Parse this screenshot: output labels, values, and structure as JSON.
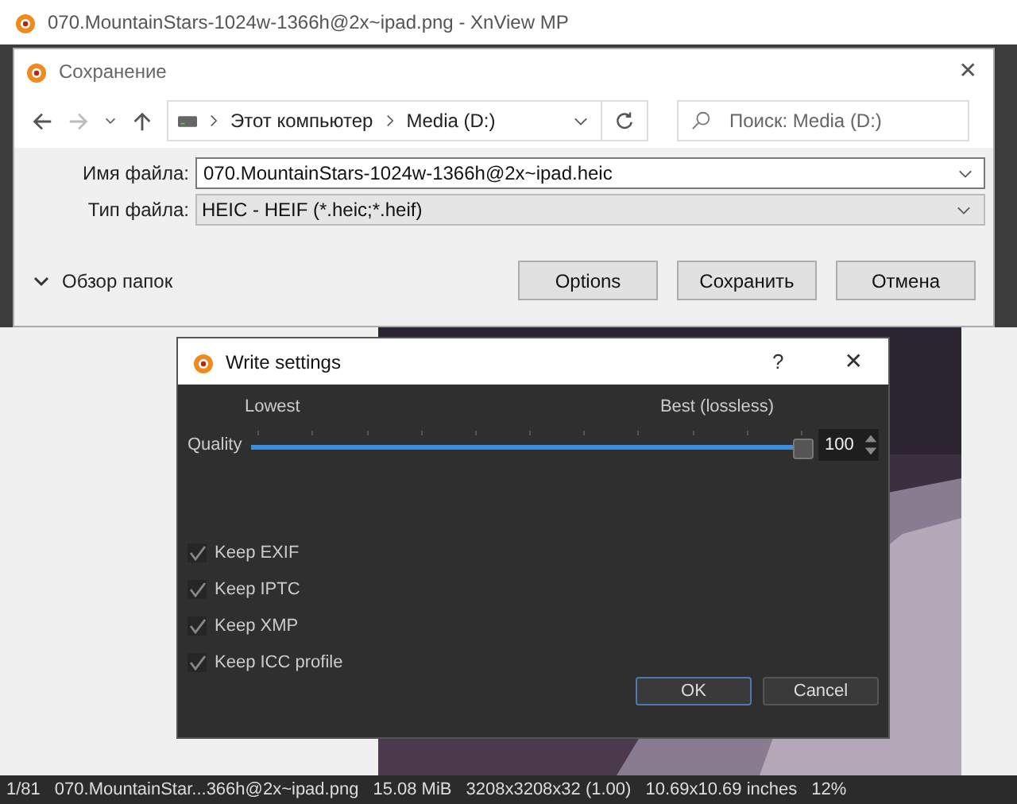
{
  "main_window": {
    "title": "070.MountainStars-1024w-1366h@2x~ipad.png - XnView MP"
  },
  "save_dialog": {
    "title": "Сохранение",
    "close": "✕",
    "breadcrumb": [
      "Этот компьютер",
      "Media (D:)"
    ],
    "search": {
      "placeholder": "Поиск: Media (D:)"
    },
    "fields": [
      {
        "label": "Имя файла:",
        "value": "070.MountainStars-1024w-1366h@2x~ipad.heic",
        "kind": "input"
      },
      {
        "label": "Тип файла:",
        "value": "HEIC - HEIF (*.heic;*.heif)",
        "kind": "select"
      }
    ],
    "browse_toggle": "Обзор папок",
    "buttons": [
      "Options",
      "Сохранить",
      "Отмена"
    ]
  },
  "write_dialog": {
    "title": "Write settings",
    "help": "?",
    "close": "✕",
    "quality": {
      "label": "Quality",
      "min_label": "Lowest",
      "max_label": "Best (lossless)",
      "level": 1,
      "value": "100"
    },
    "options": [
      {
        "label": "Keep EXIF",
        "checked": true
      },
      {
        "label": "Keep IPTC",
        "checked": true
      },
      {
        "label": "Keep XMP",
        "checked": true
      },
      {
        "label": "Keep ICC profile",
        "checked": true
      }
    ],
    "buttons": [
      {
        "label": "OK",
        "default": true
      },
      {
        "label": "Cancel",
        "default": false
      }
    ]
  },
  "status_bar": [
    "1/81",
    "070.MountainStar...366h@2x~ipad.png",
    "15.08 MiB",
    "3208x3208x32 (1.00)",
    "10.69x10.69 inches",
    "12%"
  ]
}
